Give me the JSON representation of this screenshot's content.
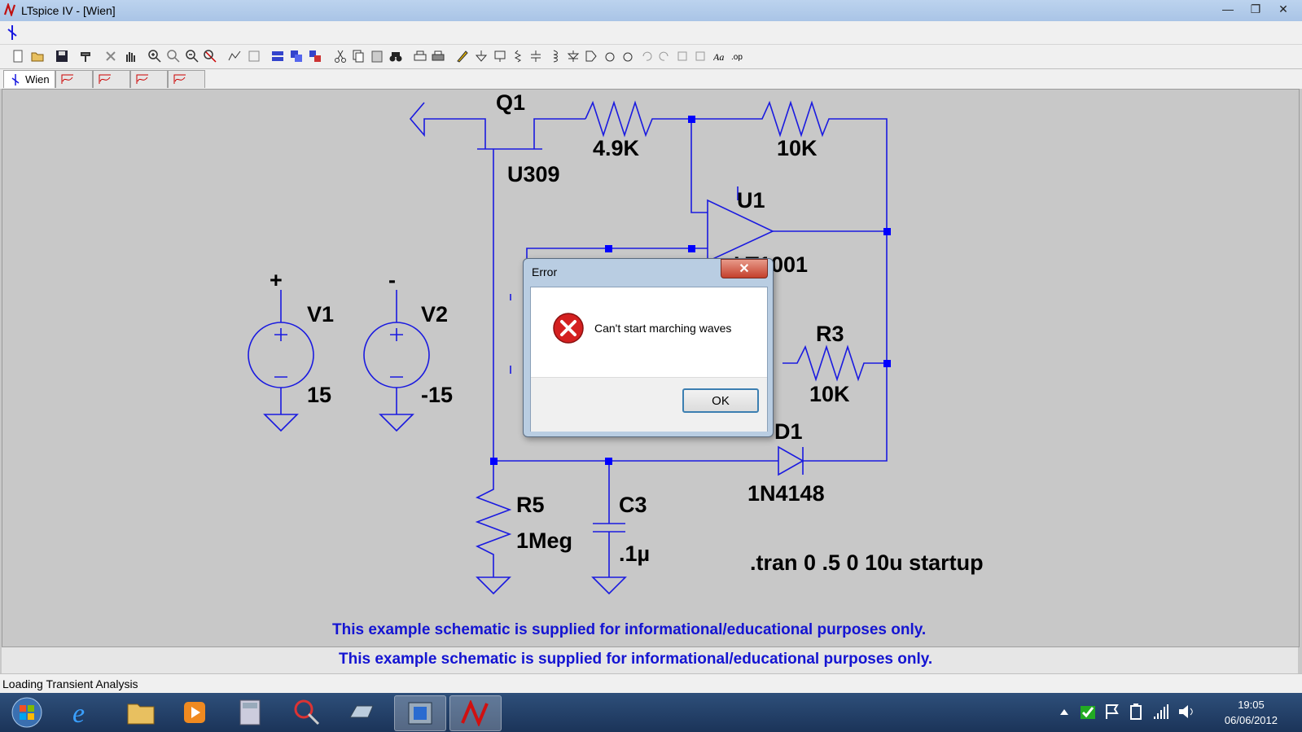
{
  "window": {
    "title": "LTspice IV - [Wien]",
    "min": "—",
    "max": "❐",
    "close": "✕"
  },
  "tabs": [
    {
      "label": "Wien"
    }
  ],
  "schematic": {
    "labels": {
      "q1": "Q1",
      "q1_model": "U309",
      "r2_value": "4.9K",
      "r1_value": "10K",
      "u1": "U1",
      "u1_model": "LT1001",
      "v1": "V1",
      "v1_value": "15",
      "v2": "V2",
      "v2_value": "-15",
      "r3": "R3",
      "r3_value": "10K",
      "d1": "D1",
      "d1_model": "1N4148",
      "r5": "R5",
      "r5_value": "1Meg",
      "c3": "C3",
      "c3_value": ".1µ",
      "directive": ".tran 0 .5 0 10u startup",
      "plus_sign": "+",
      "minus_sign": "-"
    },
    "note": "This example schematic is supplied for informational/educational purposes only."
  },
  "dialog": {
    "title": "Error",
    "message": "Can't start marching waves",
    "ok_label": "OK",
    "close": "✕"
  },
  "status": {
    "text": "Loading Transient Analysis"
  },
  "taskbar": {
    "time": "19:05",
    "date": "06/06/2012"
  },
  "colors": {
    "wire": "#1a1ae0",
    "node": "#0000ff",
    "canvas": "#c8c8c8",
    "note": "#1414d2"
  }
}
